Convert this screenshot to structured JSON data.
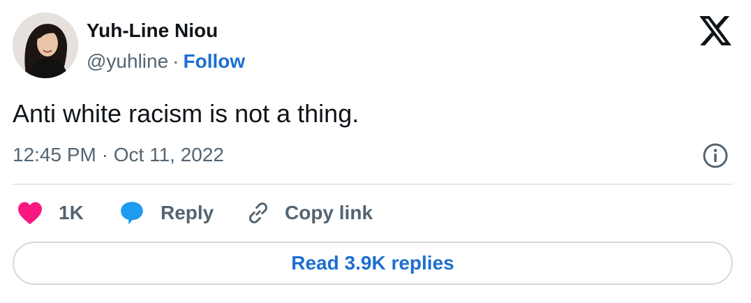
{
  "author": {
    "name": "Yuh-Line Niou",
    "handle": "@yuhline",
    "separator": "·",
    "follow_label": "Follow"
  },
  "tweet": {
    "text": "Anti white racism is not a thing.",
    "timestamp": "12:45 PM · Oct 11, 2022"
  },
  "actions": {
    "like_count": "1K",
    "reply_label": "Reply",
    "copy_link_label": "Copy link"
  },
  "read_replies_label": "Read 3.9K replies",
  "icons": {
    "logo": "x-logo-icon",
    "info": "info-icon",
    "like": "heart-icon",
    "reply": "speech-bubble-icon",
    "copy": "link-icon"
  },
  "colors": {
    "accent": "#1d6fce",
    "like": "#f91880",
    "reply": "#1d9bf0",
    "muted": "#536471",
    "text": "#0f1419",
    "border": "#cfd9de"
  }
}
